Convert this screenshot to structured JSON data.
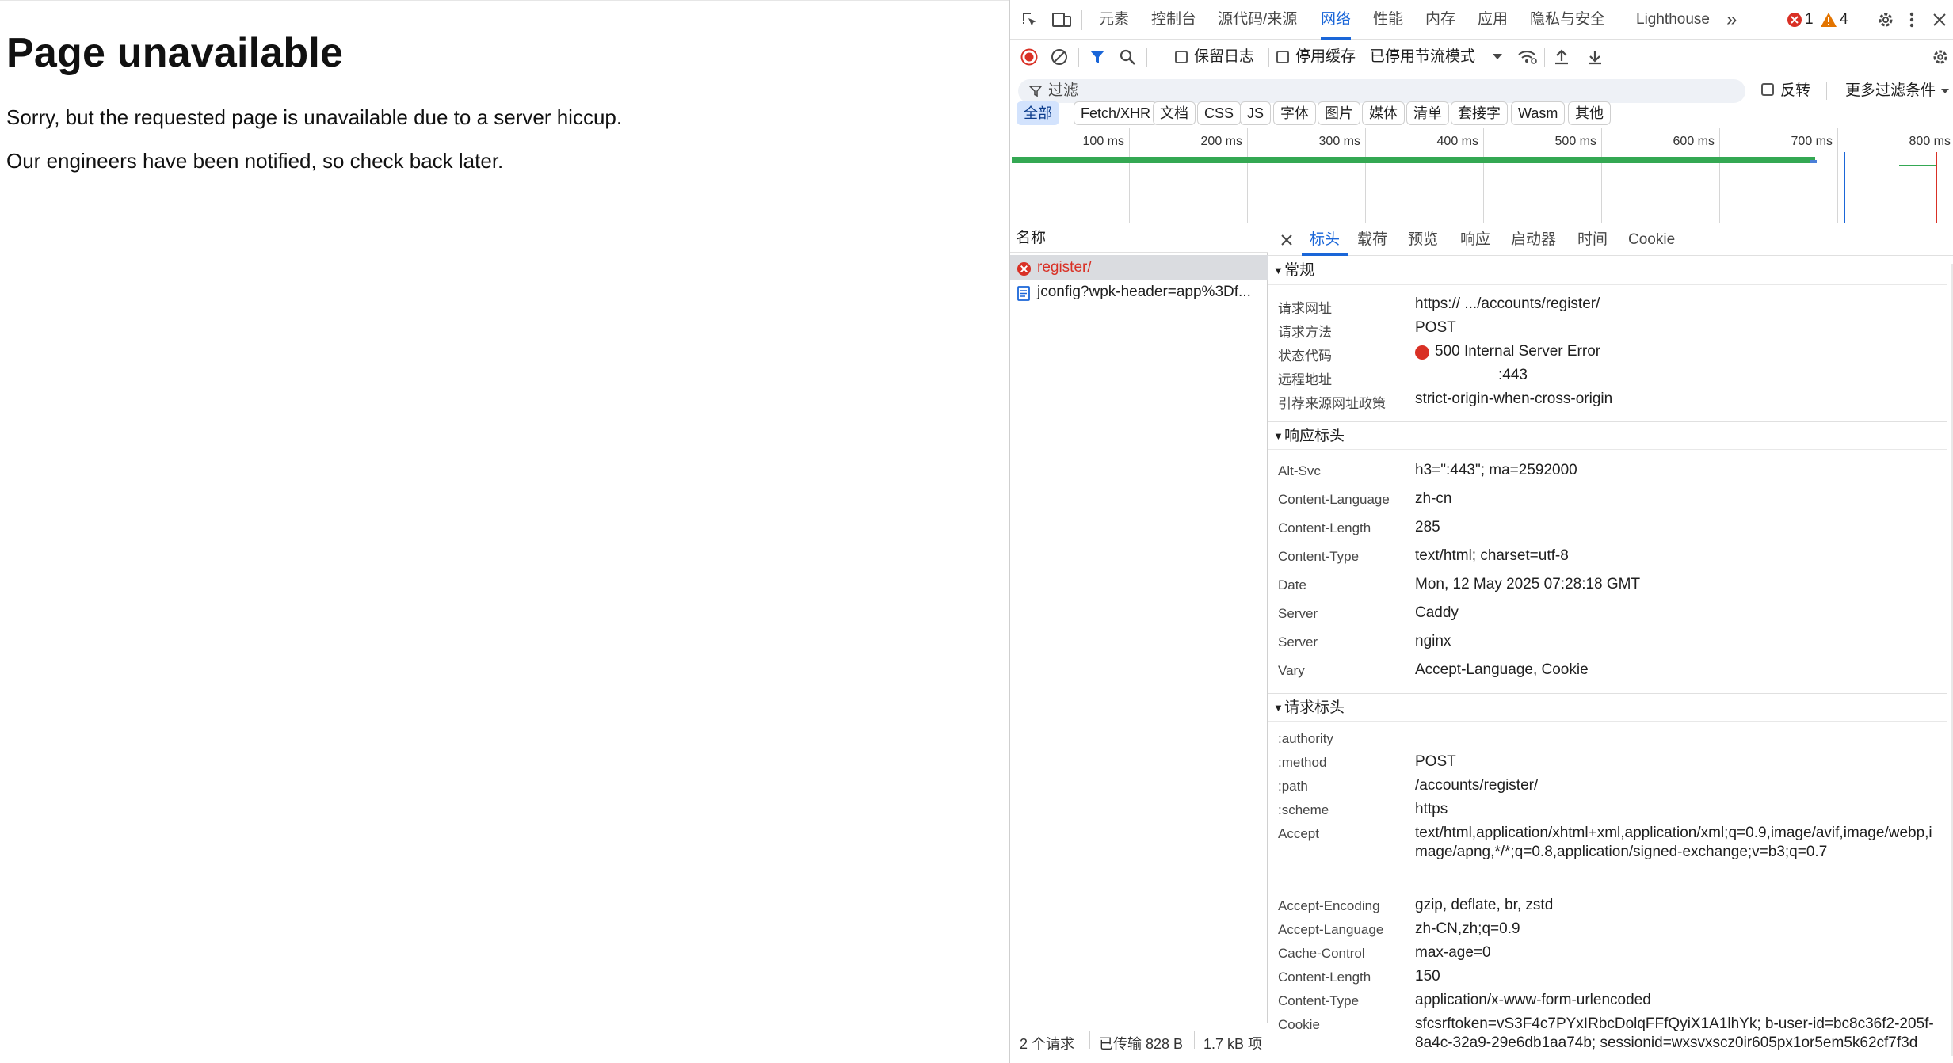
{
  "page": {
    "heading": "Page unavailable",
    "line1": "Sorry, but the requested page is unavailable due to a server hiccup.",
    "line2": "Our engineers have been notified, so check back later."
  },
  "devtools": {
    "tabs": [
      "元素",
      "控制台",
      "源代码/来源",
      "网络",
      "性能",
      "内存",
      "应用",
      "隐私与安全",
      "Lighthouse"
    ],
    "active_tab": "网络",
    "more_tabs": "»",
    "error_count": "1",
    "warning_count": "4",
    "toolbar": {
      "preserve_log": "保留日志",
      "disable_cache": "停用缓存",
      "throttling": "已停用节流模式"
    },
    "filter": {
      "placeholder": "过滤",
      "invert": "反转",
      "more_filters": "更多过滤条件"
    },
    "type_chips": [
      "全部",
      "Fetch/XHR",
      "文档",
      "CSS",
      "JS",
      "字体",
      "图片",
      "媒体",
      "清单",
      "套接字",
      "Wasm",
      "其他"
    ],
    "selected_chip": "全部",
    "timeline": {
      "ticks": [
        "100 ms",
        "200 ms",
        "300 ms",
        "400 ms",
        "500 ms",
        "600 ms",
        "700 ms",
        "800 ms"
      ]
    },
    "requests": {
      "header": "名称",
      "items": [
        {
          "name": "register/",
          "status": "error"
        },
        {
          "name": "jconfig?wpk-header=app%3Df...",
          "status": "ok"
        }
      ],
      "status_bar": {
        "count": "2 个请求",
        "transferred": "已传输 828 B",
        "resources": "1.7 kB 项"
      }
    },
    "details": {
      "tabs": [
        "标头",
        "载荷",
        "预览",
        "响应",
        "启动器",
        "时间",
        "Cookie"
      ],
      "active_tab": "标头",
      "general": {
        "title": "常规",
        "rows": [
          {
            "key": "请求网址",
            "value": "https://              .../accounts/register/"
          },
          {
            "key": "请求方法",
            "value": "POST"
          },
          {
            "key": "状态代码",
            "value": "500 Internal Server Error"
          },
          {
            "key": "远程地址",
            "value": ":443"
          },
          {
            "key": "引荐来源网址政策",
            "value": "strict-origin-when-cross-origin"
          }
        ]
      },
      "response_headers": {
        "title": "响应标头",
        "rows": [
          {
            "key": "Alt-Svc",
            "value": "h3=\":443\"; ma=2592000"
          },
          {
            "key": "Content-Language",
            "value": "zh-cn"
          },
          {
            "key": "Content-Length",
            "value": "285"
          },
          {
            "key": "Content-Type",
            "value": "text/html; charset=utf-8"
          },
          {
            "key": "Date",
            "value": "Mon, 12 May 2025 07:28:18 GMT"
          },
          {
            "key": "Server",
            "value": "Caddy"
          },
          {
            "key": "Server",
            "value": "nginx"
          },
          {
            "key": "Vary",
            "value": "Accept-Language, Cookie"
          }
        ]
      },
      "request_headers": {
        "title": "请求标头",
        "rows": [
          {
            "key": ":authority",
            "value": ""
          },
          {
            "key": ":method",
            "value": "POST"
          },
          {
            "key": ":path",
            "value": "/accounts/register/"
          },
          {
            "key": ":scheme",
            "value": "https"
          },
          {
            "key": "Accept",
            "value": "text/html,application/xhtml+xml,application/xml;q=0.9,image/avif,image/webp,image/apng,*/*;q=0.8,application/signed-exchange;v=b3;q=0.7"
          },
          {
            "key": "Accept-Encoding",
            "value": "gzip, deflate, br, zstd"
          },
          {
            "key": "Accept-Language",
            "value": "zh-CN,zh;q=0.9"
          },
          {
            "key": "Cache-Control",
            "value": "max-age=0"
          },
          {
            "key": "Content-Length",
            "value": "150"
          },
          {
            "key": "Content-Type",
            "value": "application/x-www-form-urlencoded"
          },
          {
            "key": "Cookie",
            "value": "sfcsrftoken=vS3F4c7PYxIRbcDolqFFfQyiX1A1lhYk; b-user-id=bc8c36f2-205f-8a4c-32a9-29e6db1aa74b; sessionid=wxsvxscz0ir605px1or5em5k62cf7f3d"
          }
        ]
      }
    },
    "colors": {
      "accent": "#1a66d8",
      "error": "#d93025",
      "warning": "#e37400",
      "timeline_bar": "#34a853"
    }
  }
}
